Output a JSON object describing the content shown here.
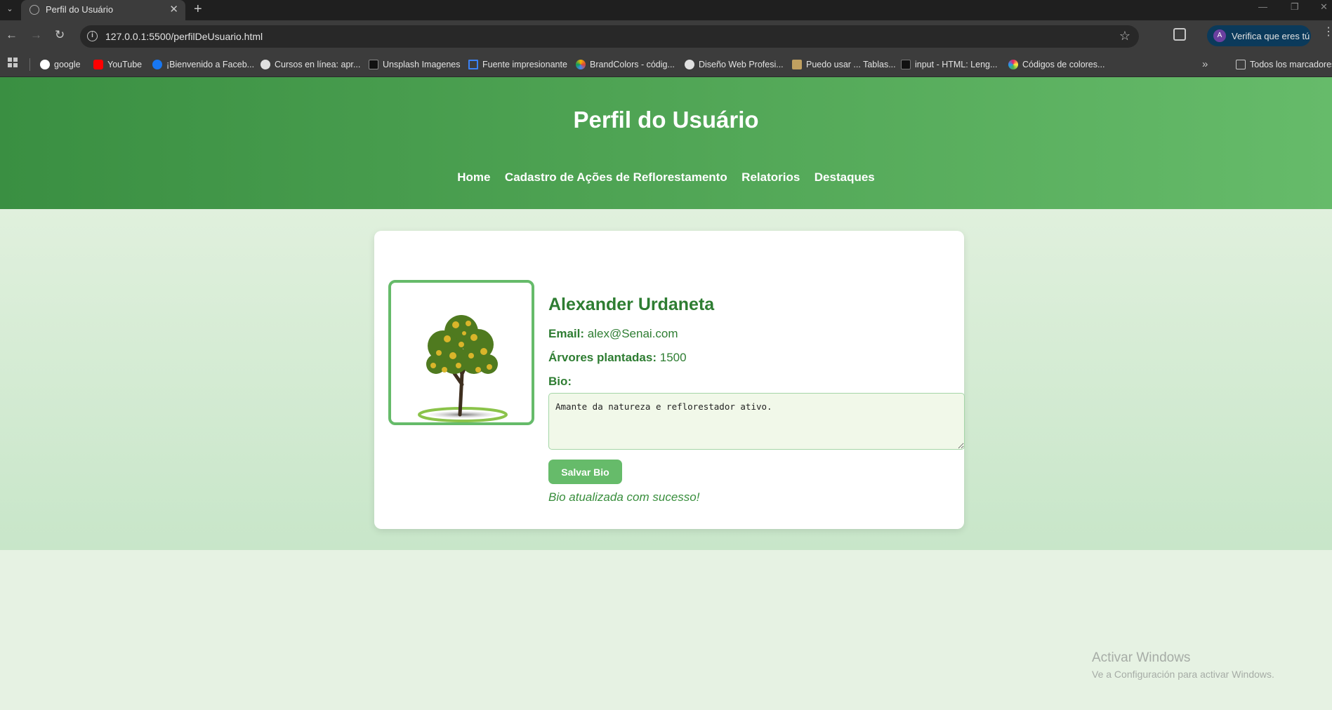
{
  "browser": {
    "tab_title": "Perfil do Usuário",
    "url": "127.0.0.1:5500/perfilDeUsuario.html",
    "profile_label": "Verifica que eres tú",
    "profile_initial": "A",
    "bookmarks": [
      {
        "label": "google",
        "color": "#ffffff"
      },
      {
        "label": "YouTube",
        "color": "#ff0000"
      },
      {
        "label": "¡Bienvenido a Faceb...",
        "color": "#1877f2"
      },
      {
        "label": "Cursos en línea: apr...",
        "color": "#e0e0e0"
      },
      {
        "label": "Unsplash Imagenes",
        "color": "#111111"
      },
      {
        "label": "Fuente impresionante",
        "color": "#3b82f6"
      },
      {
        "label": "BrandColors - códig...",
        "color": "#f4b400"
      },
      {
        "label": "Diseño Web Profesi...",
        "color": "#e0e0e0"
      },
      {
        "label": "Puedo usar ... Tablas...",
        "color": "#c0a060"
      },
      {
        "label": "input - HTML: Leng...",
        "color": "#111111"
      },
      {
        "label": "Códigos de colores...",
        "color": "#e91e63"
      }
    ],
    "all_bookmarks": "Todos los marcadores"
  },
  "header": {
    "title": "Perfil do Usuário",
    "nav": [
      "Home",
      "Cadastro de Ações de Reflorestamento",
      "Relatorios",
      "Destaques"
    ]
  },
  "profile": {
    "name": "Alexander Urdaneta",
    "email_label": "Email:",
    "email": "alex@Senai.com",
    "trees_label": "Árvores plantadas:",
    "trees": "1500",
    "bio_label": "Bio:",
    "bio": "Amante da natureza e reflorestador ativo.",
    "save_button": "Salvar Bio",
    "success_message": "Bio atualizada com sucesso!"
  },
  "watermark": {
    "title": "Activar Windows",
    "subtitle": "Ve a Configuración para activar Windows."
  }
}
